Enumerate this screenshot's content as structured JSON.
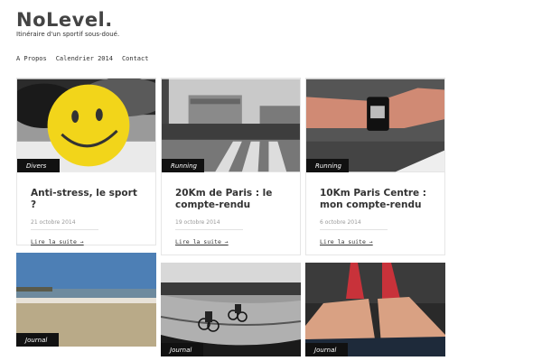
{
  "site": {
    "title": "NoLevel.",
    "description": "Itinéraire d'un sportif sous-doué."
  },
  "nav": [
    "A Propos",
    "Calendrier 2014",
    "Contact"
  ],
  "posts": [
    {
      "category": "Divers",
      "title": "Anti-stress, le sport ?",
      "date": "21 octobre 2014",
      "more": "Lire la suite →"
    },
    {
      "category": "Running",
      "title": "20Km de Paris : le compte-rendu",
      "date": "19 octobre 2014",
      "more": "Lire la suite →"
    },
    {
      "category": "Running",
      "title": "10Km Paris Centre : mon compte-rendu",
      "date": "6 octobre 2014",
      "more": "Lire la suite →"
    }
  ],
  "journal_posts": [
    {
      "category": "Journal"
    },
    {
      "category": "Journal"
    },
    {
      "category": "Journal"
    }
  ]
}
